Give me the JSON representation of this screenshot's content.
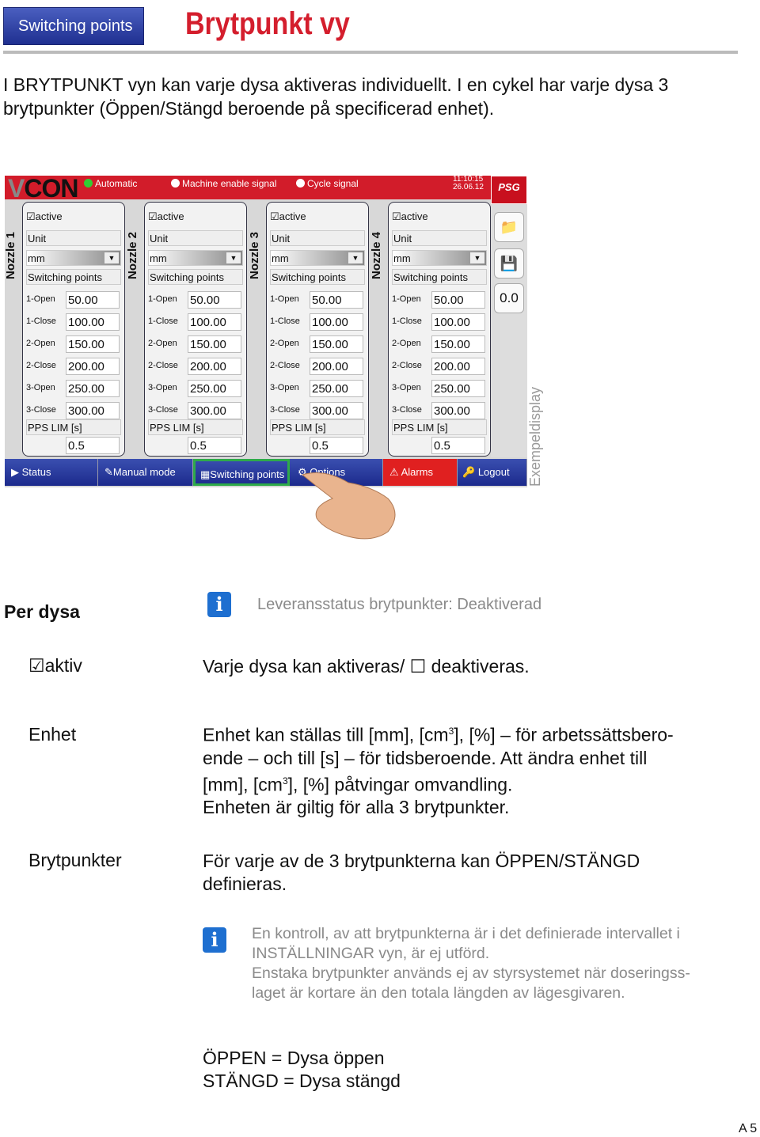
{
  "header": {
    "badge": "Switching points",
    "title": "Brytpunkt vy"
  },
  "intro": "I BRYTPUNKT vyn kan varje dysa aktiveras individuellt. I en cykel har varje dysa 3 brytpunkter (Öppen/Stängd beroende på specificerad enhet).",
  "screen": {
    "logo": "VCON",
    "signals": [
      "Automatic",
      "Machine enable signal",
      "Cycle signal"
    ],
    "time": "11:10:15",
    "date": "26.06.12",
    "brand": "PSG",
    "nozzles": [
      {
        "label": "Nozzle 1",
        "active": "active",
        "unit_label": "Unit",
        "unit": "mm",
        "sp_label": "Switching points",
        "points": [
          [
            "1-Open",
            "50.00"
          ],
          [
            "1-Close",
            "100.00"
          ],
          [
            "2-Open",
            "150.00"
          ],
          [
            "2-Close",
            "200.00"
          ],
          [
            "3-Open",
            "250.00"
          ],
          [
            "3-Close",
            "300.00"
          ]
        ],
        "pps_label": "PPS LIM [s]",
        "pps": "0.5"
      },
      {
        "label": "Nozzle 2",
        "active": "active",
        "unit_label": "Unit",
        "unit": "mm",
        "sp_label": "Switching points",
        "points": [
          [
            "1-Open",
            "50.00"
          ],
          [
            "1-Close",
            "100.00"
          ],
          [
            "2-Open",
            "150.00"
          ],
          [
            "2-Close",
            "200.00"
          ],
          [
            "3-Open",
            "250.00"
          ],
          [
            "3-Close",
            "300.00"
          ]
        ],
        "pps_label": "PPS LIM [s]",
        "pps": "0.5"
      },
      {
        "label": "Nozzle 3",
        "active": "active",
        "unit_label": "Unit",
        "unit": "mm",
        "sp_label": "Switching points",
        "points": [
          [
            "1-Open",
            "50.00"
          ],
          [
            "1-Close",
            "100.00"
          ],
          [
            "2-Open",
            "150.00"
          ],
          [
            "2-Close",
            "200.00"
          ],
          [
            "3-Open",
            "250.00"
          ],
          [
            "3-Close",
            "300.00"
          ]
        ],
        "pps_label": "PPS LIM [s]",
        "pps": "0.5"
      },
      {
        "label": "Nozzle 4",
        "active": "active",
        "unit_label": "Unit",
        "unit": "mm",
        "sp_label": "Switching points",
        "points": [
          [
            "1-Open",
            "50.00"
          ],
          [
            "1-Close",
            "100.00"
          ],
          [
            "2-Open",
            "150.00"
          ],
          [
            "2-Close",
            "200.00"
          ],
          [
            "3-Open",
            "250.00"
          ],
          [
            "3-Close",
            "300.00"
          ]
        ],
        "pps_label": "PPS LIM [s]",
        "pps": "0.5"
      }
    ],
    "side_value": "0.0",
    "nav": [
      "Status",
      "Manual mode",
      "Switching points",
      "Options",
      "Alarms",
      "Logout"
    ],
    "accent": "#d21c2a",
    "nav_color": "#1c2a8c",
    "selected_color": "#2faa4a"
  },
  "watermark": "Exempeldisplay",
  "per_dysa": "Per dysa",
  "delivery": "Leveransstatus brytpunkter: Deaktiverad",
  "aktiv": {
    "label": "aktiv",
    "text_a": "Varje dysa kan aktiveras/",
    "text_b": "deaktiveras."
  },
  "enhet": {
    "label": "Enhet",
    "l1a": "Enhet kan ställas till [mm], [cm",
    "l1b": "], [%] – för arbetssättsbero-",
    "l2": "ende – och till [s] – för tidsberoende. Att ändra enhet till",
    "l3a": "[mm], [cm",
    "l3b": "], [%] påtvingar omvandling.",
    "l4": "Enheten är giltig för alla 3 brytpunkter.",
    "sup": "3"
  },
  "bryt": {
    "label": "Brytpunkter",
    "text": "För varje av de 3 brytpunkterna kan ÖPPEN/STÄNGD definieras."
  },
  "note": [
    "En kontroll, av att brytpunkterna är i det definierade intervallet i",
    "INSTÄLLNINGAR vyn, är ej utförd.",
    "Enstaka brytpunkter används ej av styrsystemet när doseringss-",
    "laget är kortare än den totala längden av lägesgivaren."
  ],
  "legend": [
    "ÖPPEN = Dysa öppen",
    "STÄNGD = Dysa stängd"
  ],
  "page": "A 5"
}
